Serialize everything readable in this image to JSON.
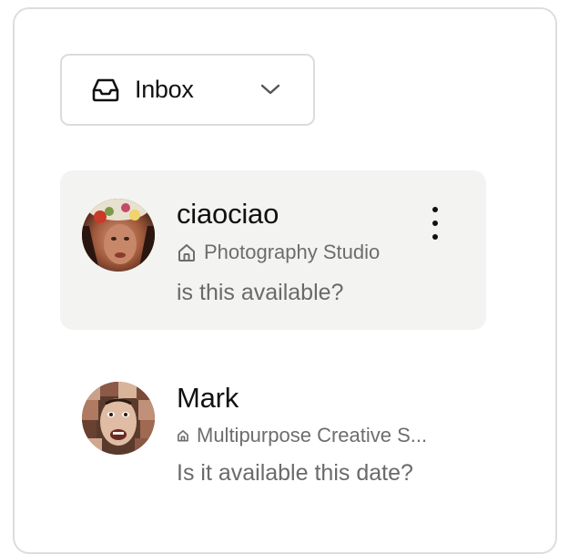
{
  "mailbox_selector": {
    "label": "Inbox",
    "icon": "inbox-tray-icon",
    "dropdown_icon": "chevron-down-icon"
  },
  "conversations": [
    {
      "name": "ciaociao",
      "listing_icon": "house-icon",
      "listing": "Photography Studio",
      "last_message": "is this available?",
      "selected": true,
      "menu_icon": "more-vertical-icon"
    },
    {
      "name": "Mark",
      "listing_icon": "house-icon",
      "listing": "Multipurpose Creative S...",
      "last_message": "Is it available this date?",
      "selected": false
    }
  ],
  "colors": {
    "selected_row_bg": "#f3f3f2",
    "border": "#dcdcdc",
    "primary_text": "#111111",
    "secondary_text": "#6d6d6d"
  }
}
